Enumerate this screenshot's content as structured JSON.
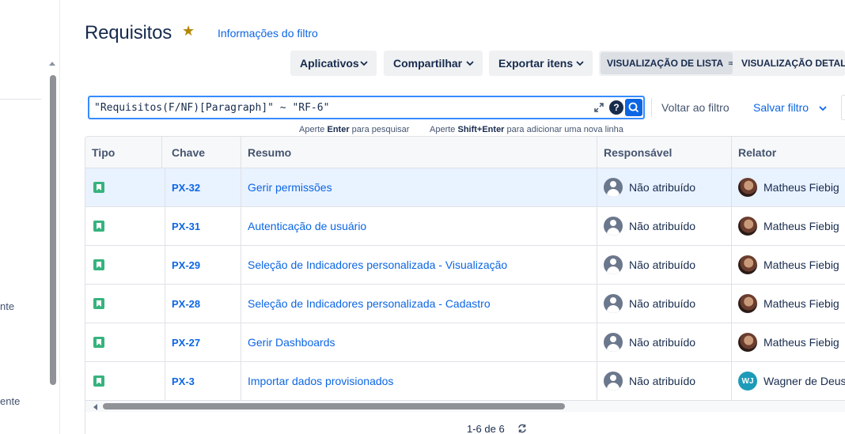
{
  "page": {
    "title": "Requisitos",
    "filter_info": "Informações do filtro"
  },
  "sidebar": {
    "fragment_1": "nte",
    "fragment_2": "ente"
  },
  "toolbar": {
    "apps": "Aplicativos",
    "share": "Compartilhar",
    "export": "Exportar itens",
    "list_view": "VISUALIZAÇÃO DE LISTA",
    "detail_view": "VISUALIZAÇÃO DETALHADA"
  },
  "search": {
    "query": "\"Requisitos(F/NF)[Paragraph]\" ~ \"RF-6\"",
    "hint_left_pre": "Aperte",
    "hint_left_key": "Enter",
    "hint_left_post": "para pesquisar",
    "hint_right_pre": "Aperte",
    "hint_right_key": "Shift+Enter",
    "hint_right_post": "para adicionar uma nova linha",
    "back_to_filter": "Voltar ao filtro",
    "save_filter": "Salvar filtro"
  },
  "table": {
    "headers": [
      "Tipo",
      "Chave",
      "Resumo",
      "Responsável",
      "Relator"
    ],
    "rows": [
      {
        "key": "PX-32",
        "summary": "Gerir permissões",
        "assignee": "Não atribuído",
        "reporter": "Matheus Fiebig",
        "reporter_avatar": "photo",
        "selected": true
      },
      {
        "key": "PX-31",
        "summary": "Autenticação de usuário",
        "assignee": "Não atribuído",
        "reporter": "Matheus Fiebig",
        "reporter_avatar": "photo"
      },
      {
        "key": "PX-29",
        "summary": "Seleção de Indicadores personalizada - Visualização",
        "assignee": "Não atribuído",
        "reporter": "Matheus Fiebig",
        "reporter_avatar": "photo"
      },
      {
        "key": "PX-28",
        "summary": "Seleção de Indicadores personalizada - Cadastro",
        "assignee": "Não atribuído",
        "reporter": "Matheus Fiebig",
        "reporter_avatar": "photo"
      },
      {
        "key": "PX-27",
        "summary": "Gerir Dashboards",
        "assignee": "Não atribuído",
        "reporter": "Matheus Fiebig",
        "reporter_avatar": "photo"
      },
      {
        "key": "PX-3",
        "summary": "Importar dados provisionados",
        "assignee": "Não atribuído",
        "reporter": "Wagner de Deus",
        "reporter_avatar": "initials",
        "reporter_initials": "WJ"
      }
    ],
    "pagination": "1-6 de 6"
  },
  "colors": {
    "brand_link": "#0c66e4",
    "story_icon": "#36b37e",
    "selected_row": "#e9f2ff",
    "star": "#b38600"
  },
  "icons": [
    "star-icon",
    "chevron-down-icon",
    "list-view-icon",
    "expand-icon",
    "help-icon",
    "search-icon",
    "story-icon",
    "user-avatar-icon",
    "refresh-icon"
  ]
}
